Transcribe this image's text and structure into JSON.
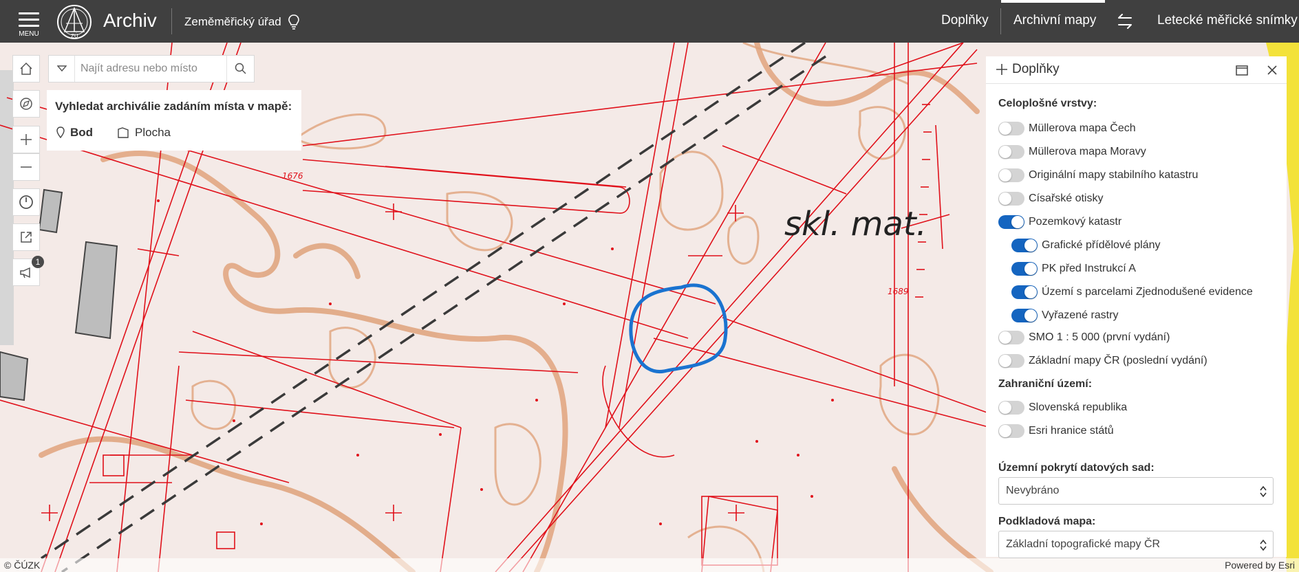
{
  "header": {
    "menu_label": "MENU",
    "logo_text": "ZÚ",
    "app_title": "Archiv",
    "office": "Zeměměřický úřad",
    "nav": [
      "Doplňky",
      "Archivní mapy",
      "Letecké měřické snímky"
    ],
    "active_nav": "Archivní mapy"
  },
  "search": {
    "placeholder": "Najít adresu nebo místo"
  },
  "pick": {
    "title": "Vyhledat archiválie zadáním místa v mapě:",
    "point": "Bod",
    "area": "Plocha"
  },
  "toolbar": {
    "badge_count": "1"
  },
  "map": {
    "label": "skl. mat."
  },
  "panel": {
    "title": "Doplňky",
    "sections": {
      "full": "Celoplošné vrstvy:",
      "foreign": "Zahraniční území:",
      "coverage": "Územní pokrytí datových sad:",
      "basemap": "Podkladová mapa:"
    },
    "layers": [
      {
        "label": "Müllerova mapa Čech",
        "on": false
      },
      {
        "label": "Müllerova mapa Moravy",
        "on": false
      },
      {
        "label": "Originální mapy stabilního katastru",
        "on": false
      },
      {
        "label": "Císařské otisky",
        "on": false
      },
      {
        "label": "Pozemkový katastr",
        "on": true
      },
      {
        "label": "Grafické přídělové plány",
        "on": true
      },
      {
        "label": "PK před Instrukcí A",
        "on": true
      },
      {
        "label": "Území s parcelami Zjednodušené evidence",
        "on": true
      },
      {
        "label": "Vyřazené rastry",
        "on": true
      },
      {
        "label": "SMO 1 : 5 000 (první vydání)",
        "on": false
      },
      {
        "label": "Základní mapy ČR (poslední vydání)",
        "on": false
      }
    ],
    "foreign_layers": [
      {
        "label": "Slovenská republika",
        "on": false
      },
      {
        "label": "Esri hranice států",
        "on": false
      }
    ],
    "coverage_value": "Nevybráno",
    "basemap_value": "Základní topografické mapy ČR"
  },
  "footer": {
    "left": "© ČÚZK",
    "right": "Powered by Esri"
  },
  "colors": {
    "header": "#404040",
    "toggle_on": "#1565c0",
    "map_bg": "#f4eae7",
    "map_lines": "#e0101a",
    "contour": "#e0a37c",
    "marker": "#1a73d0"
  }
}
